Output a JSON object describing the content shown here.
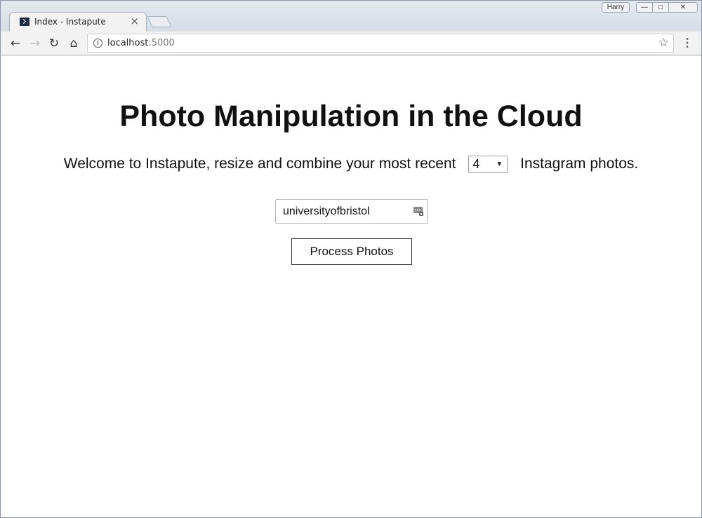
{
  "browser": {
    "tab_title": "Index - Instapute",
    "tab_close": "×",
    "profile_name": "Harry",
    "url_host": "localhost",
    "url_port": ":5000",
    "window_controls": {
      "minimize": "—",
      "maximize": "□",
      "close": "✕"
    }
  },
  "page": {
    "title": "Photo Manipulation in the Cloud",
    "welcome_prefix": "Welcome to Instapute, resize and combine your most recent",
    "photo_count": "4",
    "welcome_suffix": "Instagram photos.",
    "username_value": "universityofbristol",
    "process_button": "Process Photos"
  },
  "icons": {
    "back": "arrow-left-icon",
    "forward": "arrow-right-icon",
    "reload": "reload-icon",
    "home": "home-icon",
    "info": "info-icon",
    "bookmark": "star-icon",
    "menu": "kebab-menu-icon",
    "autofill": "password-manager-icon"
  }
}
